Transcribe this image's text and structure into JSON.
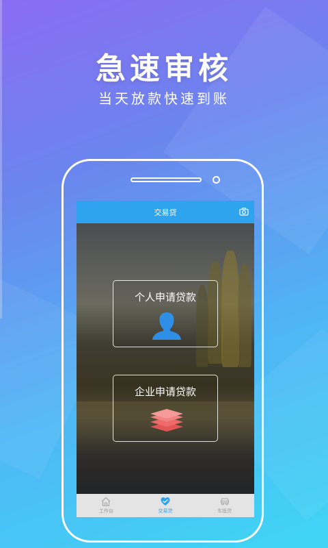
{
  "promo": {
    "headline": "急速审核",
    "subline": "当天放款快速到账"
  },
  "app": {
    "title": "交易贷",
    "camera_icon": "camera-icon",
    "accent_color": "#2ea3ee",
    "cards": [
      {
        "label": "个人申请贷款",
        "icon": "person-icon",
        "icon_color": "#2f8fe6"
      },
      {
        "label": "企业申请贷款",
        "icon": "layers-icon",
        "icon_color": "#f06a6a"
      }
    ],
    "tabs": [
      {
        "label": "工作台",
        "icon": "home-icon",
        "active": false
      },
      {
        "label": "交易贷",
        "icon": "heart-hand-icon",
        "active": true
      },
      {
        "label": "车抵贷",
        "icon": "car-icon",
        "active": false
      }
    ]
  }
}
